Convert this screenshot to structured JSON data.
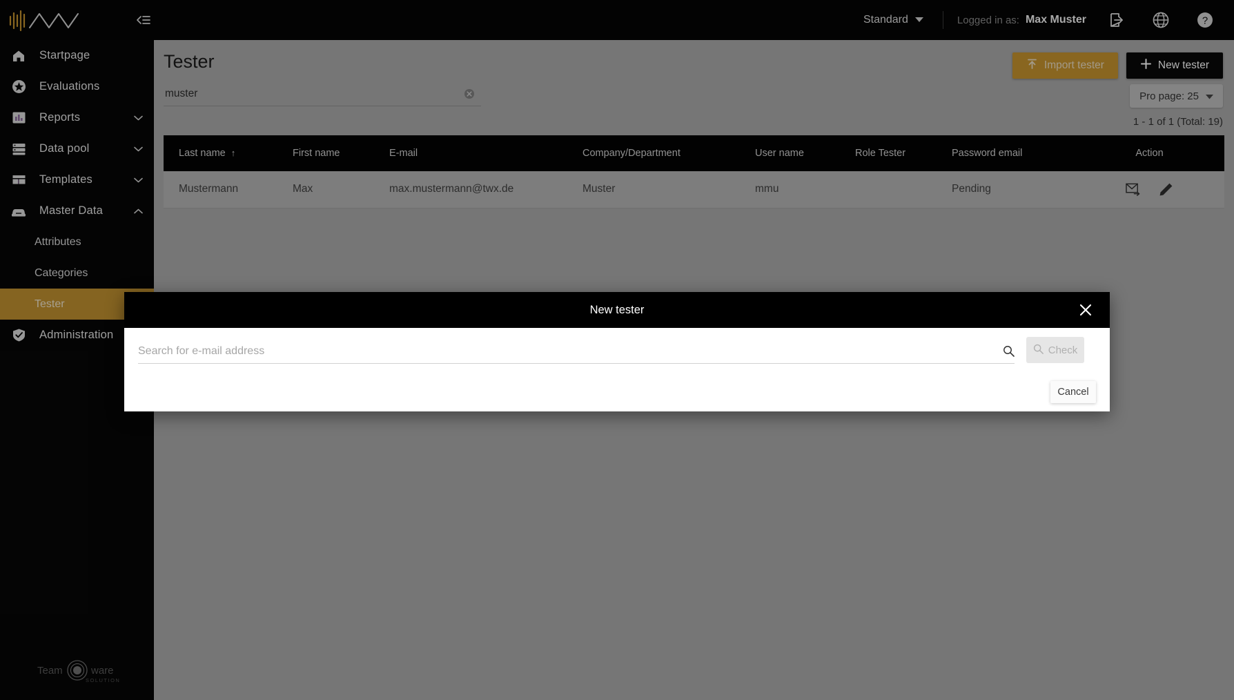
{
  "topbar": {
    "logo_name": "app-logo",
    "collapse_icon": "collapse-sidebar-icon",
    "profile_select": "Standard",
    "logged_in_label": "Logged in as:",
    "username": "Max Muster",
    "logout_icon": "logout-icon",
    "language_icon": "globe-icon",
    "help_icon": "help-icon",
    "accent_gold": "#c4922e",
    "background": "#050505"
  },
  "sidebar": {
    "items": [
      {
        "label": "Startpage",
        "icon": "home-icon",
        "expandable": false,
        "active": false
      },
      {
        "label": "Evaluations",
        "icon": "star-icon",
        "expandable": false,
        "active": false
      },
      {
        "label": "Reports",
        "icon": "bar-chart-icon",
        "expandable": true,
        "expanded": false,
        "active": false
      },
      {
        "label": "Data pool",
        "icon": "database-icon",
        "expandable": true,
        "expanded": false,
        "active": false
      },
      {
        "label": "Templates",
        "icon": "layout-icon",
        "expandable": true,
        "expanded": false,
        "active": false
      },
      {
        "label": "Master Data",
        "icon": "inbox-icon",
        "expandable": true,
        "expanded": true,
        "active": false
      }
    ],
    "master_data_children": [
      {
        "label": "Attributes",
        "active": false
      },
      {
        "label": "Categories",
        "active": false
      },
      {
        "label": "Tester",
        "active": true
      }
    ],
    "footer_items": [
      {
        "label": "Administration",
        "icon": "shield-check-icon",
        "expandable": false,
        "active": false
      }
    ],
    "brand_footer": {
      "text_left": "Team",
      "text_right": "ware",
      "subtitle": "SOLUTIONS"
    },
    "active_color": "#bf9030",
    "background": "#070707"
  },
  "page": {
    "title": "Tester",
    "search": {
      "value": "muster",
      "placeholder": "",
      "clear_icon": "clear-icon"
    },
    "actions": [
      {
        "label": "Import tester",
        "icon": "upload-icon",
        "style": "gold"
      },
      {
        "label": "New tester",
        "icon": "plus-icon",
        "style": "dark"
      }
    ],
    "per_page": {
      "label": "Pro page: 25",
      "chevron": "chevron-down-icon"
    },
    "pagination": "1 - 1 of 1 (Total: 19)"
  },
  "table": {
    "columns": [
      {
        "key": "last_name",
        "label": "Last name",
        "sorted": true,
        "sort_dir": "asc"
      },
      {
        "key": "first_name",
        "label": "First name",
        "sorted": false
      },
      {
        "key": "email",
        "label": "E-mail",
        "sorted": false
      },
      {
        "key": "company",
        "label": "Company/Department",
        "sorted": false
      },
      {
        "key": "user_name",
        "label": "User name",
        "sorted": false
      },
      {
        "key": "role",
        "label": "Role Tester",
        "sorted": false
      },
      {
        "key": "password",
        "label": "Password email",
        "sorted": false
      },
      {
        "key": "action",
        "label": "Action",
        "sorted": false
      }
    ],
    "sort_arrow": "↑",
    "rows": [
      {
        "last_name": "Mustermann",
        "first_name": "Max",
        "email": "max.mustermann@twx.de",
        "company": "Muster",
        "user_name": "mmu",
        "role": "",
        "password": "Pending",
        "actions": [
          {
            "icon": "send-mail-icon",
            "name": "send-password-email-button"
          },
          {
            "icon": "pencil-icon",
            "name": "edit-tester-button"
          }
        ]
      }
    ]
  },
  "modal": {
    "title": "New tester",
    "close_icon": "close-icon",
    "search": {
      "value": "",
      "placeholder": "Search for e-mail address",
      "icon": "search-icon"
    },
    "check_button": {
      "label": "Check",
      "icon": "search-icon",
      "disabled": true
    },
    "cancel_button": {
      "label": "Cancel"
    }
  }
}
